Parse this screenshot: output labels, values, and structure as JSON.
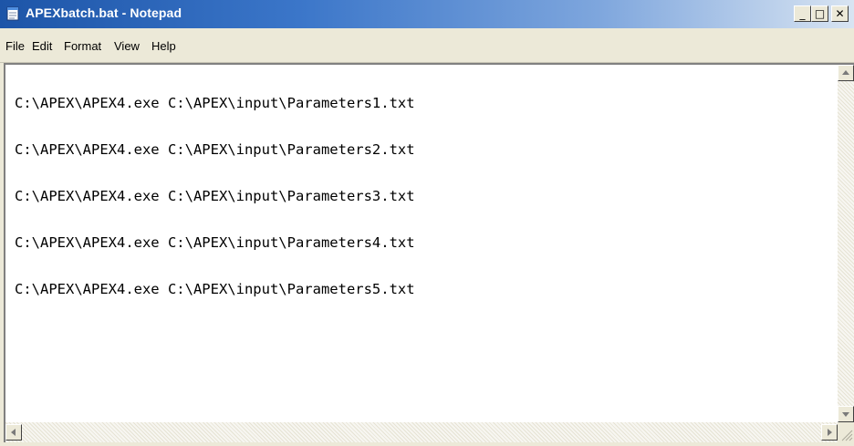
{
  "window": {
    "title": "APEXbatch.bat - Notepad",
    "controls": {
      "minimize": "_",
      "maximize": "□",
      "close": "✕"
    }
  },
  "menu": [
    "File",
    "Edit",
    "Format",
    "View",
    "Help"
  ],
  "editor": {
    "lines": [
      "C:\\APEX\\APEX4.exe C:\\APEX\\input\\Parameters1.txt",
      "C:\\APEX\\APEX4.exe C:\\APEX\\input\\Parameters2.txt",
      "C:\\APEX\\APEX4.exe C:\\APEX\\input\\Parameters3.txt",
      "C:\\APEX\\APEX4.exe C:\\APEX\\input\\Parameters4.txt",
      "C:\\APEX\\APEX4.exe C:\\APEX\\input\\Parameters5.txt"
    ]
  },
  "icons": {
    "app": "notepad-icon",
    "scroll_up": "arrow-up-icon",
    "scroll_down": "arrow-down-icon",
    "scroll_left": "arrow-left-icon",
    "scroll_right": "arrow-right-icon"
  }
}
